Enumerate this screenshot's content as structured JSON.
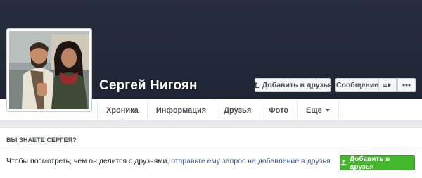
{
  "profile": {
    "name": "Сергей Нигоян",
    "photo_alt": ""
  },
  "header_actions": {
    "add_friend_label": "Добавить в друзья",
    "message_label": "Сообщение",
    "follow_icon": "follow-icon",
    "more_icon": "more-dots-icon"
  },
  "nav": {
    "tabs": [
      {
        "label": "Хроника",
        "active": true
      },
      {
        "label": "Информация"
      },
      {
        "label": "Друзья"
      },
      {
        "label": "Фото"
      },
      {
        "label": "Еще",
        "has_caret": true
      }
    ]
  },
  "know_box": {
    "title": "ВЫ ЗНАЕТЕ СЕРГЕЯ?",
    "text_prefix": "Чтобы посмотреть, чем он делится с друзьями, ",
    "link_text": "отправьте ему запрос на добавление в друзья",
    "text_suffix": ".",
    "button_label": "Добавить в друзья"
  },
  "colors": {
    "cover": "#232a39",
    "accent_green": "#42b72a",
    "link": "#365899"
  }
}
